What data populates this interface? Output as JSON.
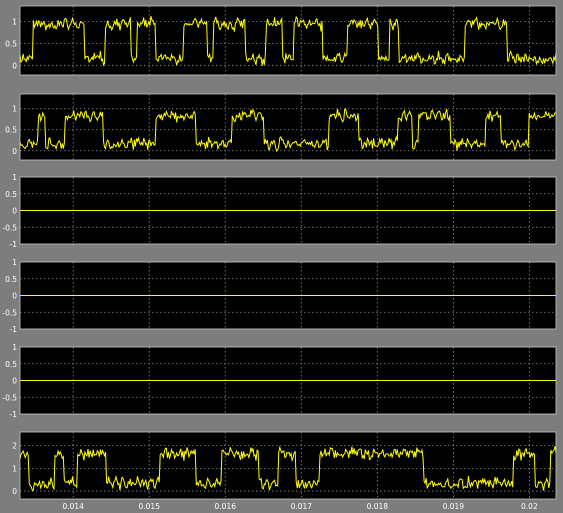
{
  "chart_data": [
    {
      "type": "line",
      "xlim": [
        0.0133,
        0.02035
      ],
      "ylim": [
        -0.22,
        1.35
      ],
      "yticks": [
        "0",
        "0.5",
        "1"
      ],
      "grid": true,
      "series": [
        {
          "color": "#ffff00",
          "mean": 0.55,
          "amplitude": 0.45,
          "noise": 0.09,
          "seed": 11,
          "x_range": [
            0.0133,
            0.02035
          ],
          "y_range": [
            -0.15,
            1.25
          ]
        }
      ]
    },
    {
      "type": "line",
      "xlim": [
        0.0133,
        0.02035
      ],
      "ylim": [
        -0.22,
        1.35
      ],
      "yticks": [
        "0",
        "0.5",
        "1"
      ],
      "grid": true,
      "series": [
        {
          "color": "#ffff00",
          "mean": 0.5,
          "amplitude": 0.38,
          "noise": 0.09,
          "seed": 23,
          "x_range": [
            0.0133,
            0.02035
          ],
          "y_range": [
            -0.15,
            1.2
          ]
        }
      ]
    },
    {
      "type": "line",
      "xlim": [
        0.0133,
        0.02035
      ],
      "ylim": [
        -1,
        1
      ],
      "yticks": [
        "-1",
        "-0.5",
        "0",
        "0.5",
        "1"
      ],
      "grid": true,
      "series": [
        {
          "color": "#ffff00",
          "constant": 0,
          "x": [
            0.0133,
            0.02035
          ],
          "y": [
            0,
            0
          ]
        }
      ]
    },
    {
      "type": "line",
      "xlim": [
        0.0133,
        0.02035
      ],
      "ylim": [
        -1,
        1
      ],
      "yticks": [
        "-1",
        "-0.5",
        "0",
        "0.5",
        "1"
      ],
      "grid": true,
      "series": [
        {
          "color": "#ffff00",
          "constant": 0,
          "x": [
            0.0133,
            0.02035
          ],
          "y": [
            0,
            0
          ]
        }
      ]
    },
    {
      "type": "line",
      "xlim": [
        0.0133,
        0.02035
      ],
      "ylim": [
        -1,
        1
      ],
      "yticks": [
        "-1",
        "-0.5",
        "0",
        "0.5",
        "1"
      ],
      "grid": true,
      "series": [
        {
          "color": "#ffff00",
          "constant": 0,
          "x": [
            0.0133,
            0.02035
          ],
          "y": [
            0,
            0
          ]
        }
      ]
    },
    {
      "type": "line",
      "xlim": [
        0.0133,
        0.02035
      ],
      "ylim": [
        -0.35,
        2.6
      ],
      "yticks": [
        "0",
        "1",
        "2"
      ],
      "xticks": [
        "0.014",
        "0.015",
        "0.016",
        "0.017",
        "0.018",
        "0.019",
        "0.02"
      ],
      "grid": true,
      "series": [
        {
          "color": "#ffff00",
          "mean": 1.0,
          "amplitude": 0.75,
          "noise": 0.18,
          "seed": 37,
          "x_range": [
            0.0133,
            0.02035
          ],
          "y_range": [
            -0.25,
            2.3
          ]
        }
      ]
    }
  ]
}
